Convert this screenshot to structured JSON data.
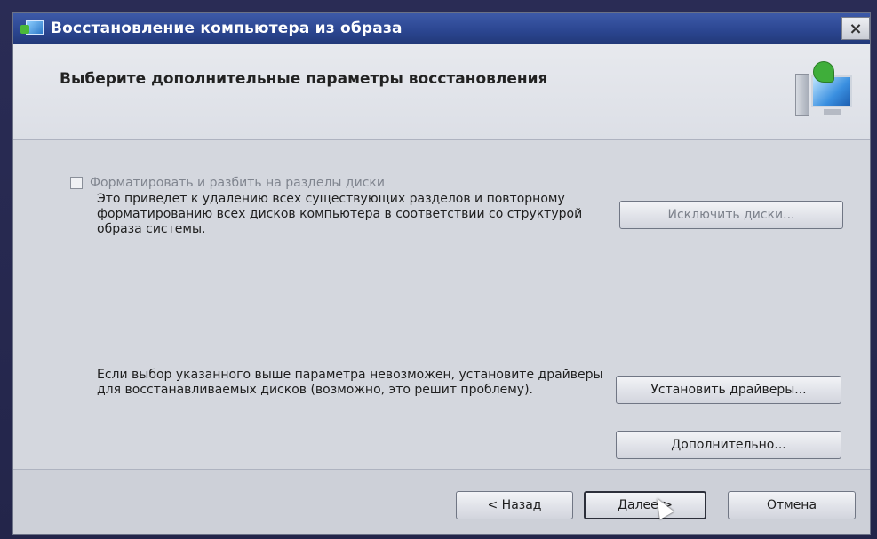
{
  "window": {
    "title": "Восстановление компьютера из образа",
    "close_symbol": "×"
  },
  "header": {
    "title": "Выберите дополнительные параметры восстановления",
    "icon": "computer-restore-icon"
  },
  "format_option": {
    "checkbox_label": "Форматировать и разбить на разделы диски",
    "checked": false,
    "description": "Это приведет к удалению всех существующих разделов и повторному форматированию всех дисков компьютера в соответствии со структурой образа системы.",
    "exclude_button": "Исключить диски..."
  },
  "drivers": {
    "description": "Если выбор указанного выше параметра невозможен, установите драйверы для восстанавливаемых дисков (возможно, это решит проблему).",
    "install_button": "Установить драйверы...",
    "advanced_button": "Дополнительно..."
  },
  "footer": {
    "back_button": "< Назад",
    "next_button": "Далее >",
    "cancel_button": "Отмена"
  }
}
